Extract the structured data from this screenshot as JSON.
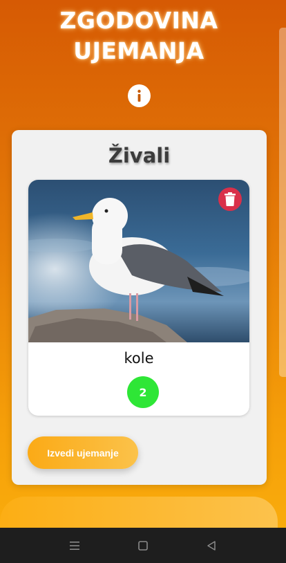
{
  "header": {
    "title_line1": "ZGODOVINA",
    "title_line2": "UJEMANJA",
    "info_icon": "info-icon"
  },
  "card": {
    "title": "Živali",
    "item": {
      "name": "kole",
      "count": "2",
      "image": "seagull-photo",
      "delete_icon": "trash-icon"
    },
    "action_label": "Izvedi ujemanje"
  },
  "navbar": {
    "icons": [
      "menu-icon",
      "home-square-icon",
      "back-triangle-icon"
    ]
  },
  "colors": {
    "delete": "#d9304a",
    "badge": "#2ee636",
    "accent": "#fbaa16"
  }
}
